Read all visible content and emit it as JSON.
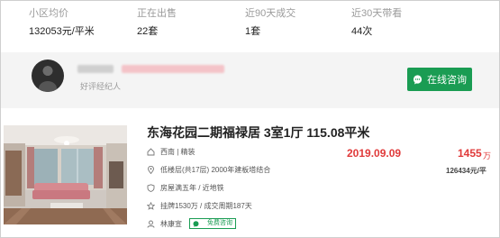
{
  "stats": [
    {
      "label": "小区均价",
      "value": "132053元/平米"
    },
    {
      "label": "正在出售",
      "value": "22套"
    },
    {
      "label": "近90天成交",
      "value": "1套"
    },
    {
      "label": "近30天带看",
      "value": "44次"
    }
  ],
  "agent": {
    "tag": "好评经纪人",
    "consult_label": "在线咨询"
  },
  "listing": {
    "title": "东海花园二期福禄居 3室1厅 115.08平米",
    "orientation": "西南 | 精装",
    "floor": "低楼层(共17层) 2000年建板塔结合",
    "tags": "房屋满五年 / 近地铁",
    "listing_info": "挂牌1530万 / 成交周期187天",
    "agent_name": "林康宣",
    "free_consult": "免费咨询",
    "date": "2019.09.09",
    "price": "1455",
    "price_unit": "万",
    "unit_price": "126434元/平"
  },
  "colors": {
    "accent_green": "#1a9c53",
    "price_red": "#e03a3a"
  }
}
